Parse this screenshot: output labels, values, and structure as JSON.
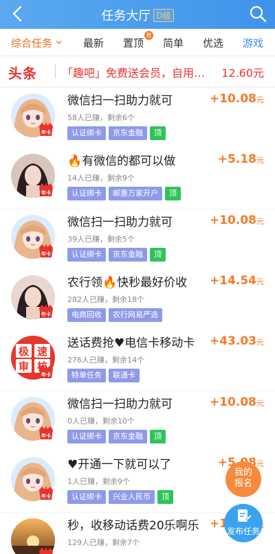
{
  "header": {
    "title": "任务大厅",
    "grade": "D级"
  },
  "tabs": [
    {
      "label": "综合任务"
    },
    {
      "label": "最新"
    },
    {
      "label": "置顶"
    },
    {
      "label": "简单"
    },
    {
      "label": "优选"
    },
    {
      "label": "游戏"
    }
  ],
  "pin_badge": "抢",
  "headline": {
    "tag": "头条",
    "text": "「趣吧」免费送会员，自用…",
    "price": "12.60元"
  },
  "avatar_badge": "年卡",
  "tasks": [
    {
      "title": "微信扫一扫助力就可",
      "participants": "58人已赚，剩余6个",
      "tags": [
        "认证绑卡",
        "京东金融"
      ],
      "top": "顶",
      "reward": "+10.08",
      "unit": "元",
      "avatar": "anime-girl"
    },
    {
      "title": "🔥有微信的都可以做",
      "participants": "14人已赚，剩余9个",
      "tags": [
        "认证绑卡",
        "邮惠万家开户"
      ],
      "top": "顶",
      "reward": "+5.18",
      "unit": "元",
      "avatar": "photo-girl"
    },
    {
      "title": "微信扫一扫助力就可",
      "participants": "39人已赚，剩余5个",
      "tags": [
        "认证绑卡",
        "京东金融"
      ],
      "top": "顶",
      "reward": "+10.08",
      "unit": "元",
      "avatar": "anime-girl"
    },
    {
      "title": "农行领🔥快秒最好价收",
      "participants": "282人已赚，剩余18个",
      "tags": [
        "电商回收",
        "农行网易严选"
      ],
      "top": "",
      "reward": "+14.54",
      "unit": "元",
      "avatar": "photo-girl-2"
    },
    {
      "title": "送话费抢♥电信卡移动卡",
      "participants": "276人已赚，剩余14个",
      "tags": [
        "特单任务",
        "联通卡"
      ],
      "top": "",
      "reward": "+43.03",
      "unit": "元",
      "avatar": "fast-review",
      "avatar_text": [
        "极",
        "速",
        "审",
        "核"
      ]
    },
    {
      "title": "微信扫一扫助力就可",
      "participants": "0人已赚，剩余10个",
      "tags": [
        "认证绑卡",
        "京东金融"
      ],
      "top": "顶",
      "reward": "+10.08",
      "unit": "元",
      "avatar": "anime-girl"
    },
    {
      "title": "♥开通一下就可以了",
      "participants": "1人已赚，剩余9个",
      "tags": [
        "认证绑卡",
        "兴业人民币"
      ],
      "top": "顶",
      "reward": "+5.08",
      "unit": "元",
      "avatar": "anime-girl"
    },
    {
      "title": "秒，收移动话费20乐啊乐",
      "participants": "129人已赚，剩余7个",
      "tags": [],
      "top": "",
      "reward": "+10.00",
      "unit": "元",
      "avatar": "sunset"
    }
  ],
  "fab": {
    "report_line1": "我的",
    "report_line2": "报名",
    "publish": "发布任务"
  },
  "colors": {
    "header_start": "#5aa9f0",
    "header_end": "#3f93ea",
    "accent_orange": "#f37a2a",
    "headline_red": "#e8312e",
    "tag_purple": "#8e9ae9",
    "tag_green": "#2fc45a"
  }
}
